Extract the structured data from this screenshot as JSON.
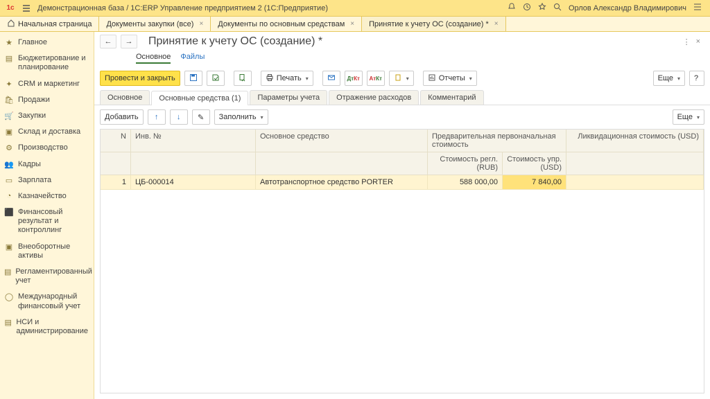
{
  "title_bar": {
    "app_title": "Демонстрационная база / 1С:ERP Управление предприятием 2  (1С:Предприятие)",
    "user_name": "Орлов Александр Владимирович"
  },
  "tabs": {
    "start": "Начальная страница",
    "t1": "Документы закупки (все)",
    "t2": "Документы по основным средствам",
    "t3": "Принятие к учету ОС (создание) *"
  },
  "sidebar": [
    "Главное",
    "Бюджетирование и планирование",
    "CRM и маркетинг",
    "Продажи",
    "Закупки",
    "Склад и доставка",
    "Производство",
    "Кадры",
    "Зарплата",
    "Казначейство",
    "Финансовый результат и контроллинг",
    "Внеоборотные активы",
    "Регламентированный учет",
    "Международный финансовый учет",
    "НСИ и администрирование"
  ],
  "doc": {
    "title": "Принятие к учету ОС (создание) *",
    "link_main": "Основное",
    "link_files": "Файлы"
  },
  "toolbar": {
    "post_close": "Провести и закрыть",
    "print": "Печать",
    "reports": "Отчеты",
    "more": "Еще",
    "help": "?"
  },
  "subtabs": {
    "t0": "Основное",
    "t1": "Основные средства (1)",
    "t2": "Параметры учета",
    "t3": "Отражение расходов",
    "t4": "Комментарий"
  },
  "gridtools": {
    "add": "Добавить",
    "fill": "Заполнить",
    "more": "Еще"
  },
  "grid": {
    "h_n": "N",
    "h_inv": "Инв. №",
    "h_os": "Основное средство",
    "h_pre": "Предварительная первоначальная стоимость",
    "h_regl": "Стоимость регл. (RUB)",
    "h_upr": "Стоимость упр. (USD)",
    "h_liq": "Ликвидационная стоимость (USD)",
    "row1": {
      "n": "1",
      "inv": "ЦБ-000014",
      "os": "Автотранспортное средство PORTER",
      "regl": "588 000,00",
      "upr": "7 840,00",
      "liq": ""
    }
  }
}
